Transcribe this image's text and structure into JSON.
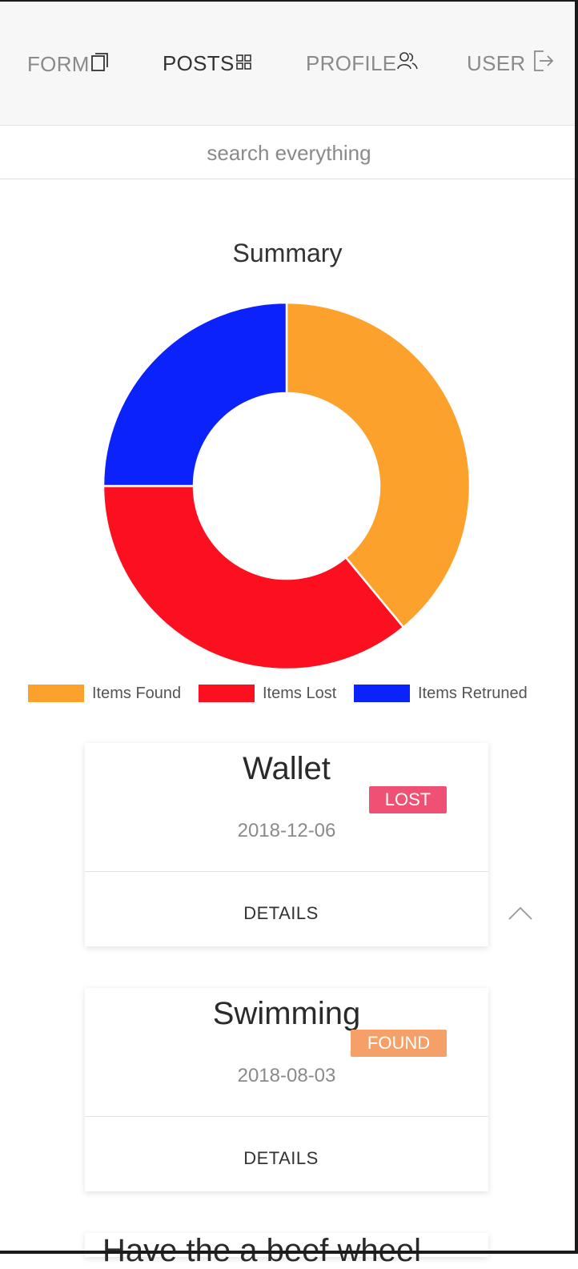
{
  "nav": {
    "items": [
      {
        "label": "FORM",
        "icon": "document-icon"
      },
      {
        "label": "POSTS",
        "icon": "grid-icon"
      },
      {
        "label": "PROFILE",
        "icon": "users-icon"
      },
      {
        "label": "USER",
        "icon": "logout-icon"
      }
    ]
  },
  "search": {
    "placeholder": "search everything",
    "value": ""
  },
  "chart_data": {
    "type": "pie",
    "title": "Summary",
    "donut": true,
    "legend_position": "bottom",
    "categories": [
      "Items Found",
      "Items Lost",
      "Items Retruned"
    ],
    "values": [
      39,
      36,
      25
    ],
    "colors": [
      "#fca22c",
      "#fc0f1e",
      "#0c22fb"
    ]
  },
  "posts": [
    {
      "title": "Wallet",
      "date": "2018-12-06",
      "status": "LOST",
      "details_label": "DETAILS"
    },
    {
      "title": "Swimming",
      "date": "2018-08-03",
      "status": "FOUND",
      "details_label": "DETAILS"
    },
    {
      "title": "Have the a beef wheel"
    }
  ],
  "colors": {
    "lost": "#ef5174",
    "found": "#f5a068",
    "nav_bg": "#f7f7f7"
  }
}
